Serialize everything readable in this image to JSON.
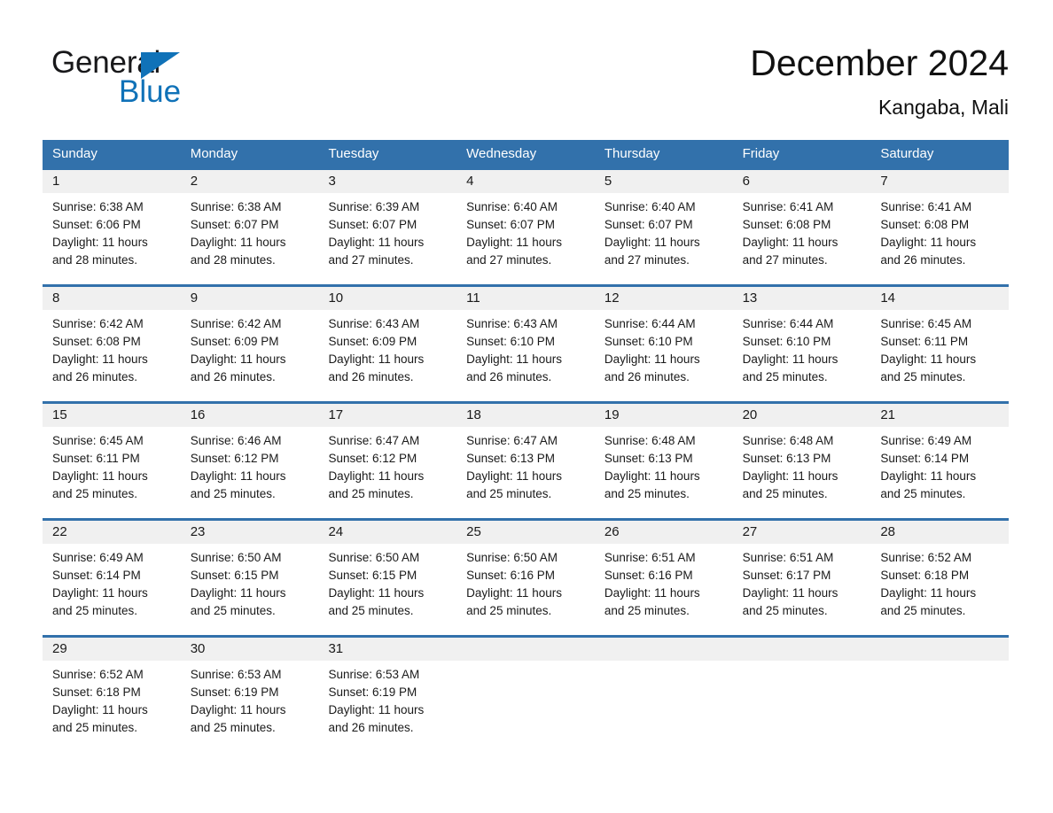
{
  "brand": {
    "name_part1": "General",
    "name_part2": "Blue",
    "logo_icon": "triangle-icon",
    "colors": {
      "blue": "#1072b8",
      "black": "#18181a"
    }
  },
  "header": {
    "title": "December 2024",
    "subtitle": "Kangaba, Mali"
  },
  "theme": {
    "header_blue": "#3271ab",
    "daybar_gray": "#f0f0f0",
    "text": "#1a1a1a",
    "page_background": "#ffffff"
  },
  "calendar": {
    "weekdays": [
      "Sunday",
      "Monday",
      "Tuesday",
      "Wednesday",
      "Thursday",
      "Friday",
      "Saturday"
    ],
    "weeks": [
      [
        {
          "day": "1",
          "sunrise": "Sunrise: 6:38 AM",
          "sunset": "Sunset: 6:06 PM",
          "daylight_line1": "Daylight: 11 hours",
          "daylight_line2": "and 28 minutes."
        },
        {
          "day": "2",
          "sunrise": "Sunrise: 6:38 AM",
          "sunset": "Sunset: 6:07 PM",
          "daylight_line1": "Daylight: 11 hours",
          "daylight_line2": "and 28 minutes."
        },
        {
          "day": "3",
          "sunrise": "Sunrise: 6:39 AM",
          "sunset": "Sunset: 6:07 PM",
          "daylight_line1": "Daylight: 11 hours",
          "daylight_line2": "and 27 minutes."
        },
        {
          "day": "4",
          "sunrise": "Sunrise: 6:40 AM",
          "sunset": "Sunset: 6:07 PM",
          "daylight_line1": "Daylight: 11 hours",
          "daylight_line2": "and 27 minutes."
        },
        {
          "day": "5",
          "sunrise": "Sunrise: 6:40 AM",
          "sunset": "Sunset: 6:07 PM",
          "daylight_line1": "Daylight: 11 hours",
          "daylight_line2": "and 27 minutes."
        },
        {
          "day": "6",
          "sunrise": "Sunrise: 6:41 AM",
          "sunset": "Sunset: 6:08 PM",
          "daylight_line1": "Daylight: 11 hours",
          "daylight_line2": "and 27 minutes."
        },
        {
          "day": "7",
          "sunrise": "Sunrise: 6:41 AM",
          "sunset": "Sunset: 6:08 PM",
          "daylight_line1": "Daylight: 11 hours",
          "daylight_line2": "and 26 minutes."
        }
      ],
      [
        {
          "day": "8",
          "sunrise": "Sunrise: 6:42 AM",
          "sunset": "Sunset: 6:08 PM",
          "daylight_line1": "Daylight: 11 hours",
          "daylight_line2": "and 26 minutes."
        },
        {
          "day": "9",
          "sunrise": "Sunrise: 6:42 AM",
          "sunset": "Sunset: 6:09 PM",
          "daylight_line1": "Daylight: 11 hours",
          "daylight_line2": "and 26 minutes."
        },
        {
          "day": "10",
          "sunrise": "Sunrise: 6:43 AM",
          "sunset": "Sunset: 6:09 PM",
          "daylight_line1": "Daylight: 11 hours",
          "daylight_line2": "and 26 minutes."
        },
        {
          "day": "11",
          "sunrise": "Sunrise: 6:43 AM",
          "sunset": "Sunset: 6:10 PM",
          "daylight_line1": "Daylight: 11 hours",
          "daylight_line2": "and 26 minutes."
        },
        {
          "day": "12",
          "sunrise": "Sunrise: 6:44 AM",
          "sunset": "Sunset: 6:10 PM",
          "daylight_line1": "Daylight: 11 hours",
          "daylight_line2": "and 26 minutes."
        },
        {
          "day": "13",
          "sunrise": "Sunrise: 6:44 AM",
          "sunset": "Sunset: 6:10 PM",
          "daylight_line1": "Daylight: 11 hours",
          "daylight_line2": "and 25 minutes."
        },
        {
          "day": "14",
          "sunrise": "Sunrise: 6:45 AM",
          "sunset": "Sunset: 6:11 PM",
          "daylight_line1": "Daylight: 11 hours",
          "daylight_line2": "and 25 minutes."
        }
      ],
      [
        {
          "day": "15",
          "sunrise": "Sunrise: 6:45 AM",
          "sunset": "Sunset: 6:11 PM",
          "daylight_line1": "Daylight: 11 hours",
          "daylight_line2": "and 25 minutes."
        },
        {
          "day": "16",
          "sunrise": "Sunrise: 6:46 AM",
          "sunset": "Sunset: 6:12 PM",
          "daylight_line1": "Daylight: 11 hours",
          "daylight_line2": "and 25 minutes."
        },
        {
          "day": "17",
          "sunrise": "Sunrise: 6:47 AM",
          "sunset": "Sunset: 6:12 PM",
          "daylight_line1": "Daylight: 11 hours",
          "daylight_line2": "and 25 minutes."
        },
        {
          "day": "18",
          "sunrise": "Sunrise: 6:47 AM",
          "sunset": "Sunset: 6:13 PM",
          "daylight_line1": "Daylight: 11 hours",
          "daylight_line2": "and 25 minutes."
        },
        {
          "day": "19",
          "sunrise": "Sunrise: 6:48 AM",
          "sunset": "Sunset: 6:13 PM",
          "daylight_line1": "Daylight: 11 hours",
          "daylight_line2": "and 25 minutes."
        },
        {
          "day": "20",
          "sunrise": "Sunrise: 6:48 AM",
          "sunset": "Sunset: 6:13 PM",
          "daylight_line1": "Daylight: 11 hours",
          "daylight_line2": "and 25 minutes."
        },
        {
          "day": "21",
          "sunrise": "Sunrise: 6:49 AM",
          "sunset": "Sunset: 6:14 PM",
          "daylight_line1": "Daylight: 11 hours",
          "daylight_line2": "and 25 minutes."
        }
      ],
      [
        {
          "day": "22",
          "sunrise": "Sunrise: 6:49 AM",
          "sunset": "Sunset: 6:14 PM",
          "daylight_line1": "Daylight: 11 hours",
          "daylight_line2": "and 25 minutes."
        },
        {
          "day": "23",
          "sunrise": "Sunrise: 6:50 AM",
          "sunset": "Sunset: 6:15 PM",
          "daylight_line1": "Daylight: 11 hours",
          "daylight_line2": "and 25 minutes."
        },
        {
          "day": "24",
          "sunrise": "Sunrise: 6:50 AM",
          "sunset": "Sunset: 6:15 PM",
          "daylight_line1": "Daylight: 11 hours",
          "daylight_line2": "and 25 minutes."
        },
        {
          "day": "25",
          "sunrise": "Sunrise: 6:50 AM",
          "sunset": "Sunset: 6:16 PM",
          "daylight_line1": "Daylight: 11 hours",
          "daylight_line2": "and 25 minutes."
        },
        {
          "day": "26",
          "sunrise": "Sunrise: 6:51 AM",
          "sunset": "Sunset: 6:16 PM",
          "daylight_line1": "Daylight: 11 hours",
          "daylight_line2": "and 25 minutes."
        },
        {
          "day": "27",
          "sunrise": "Sunrise: 6:51 AM",
          "sunset": "Sunset: 6:17 PM",
          "daylight_line1": "Daylight: 11 hours",
          "daylight_line2": "and 25 minutes."
        },
        {
          "day": "28",
          "sunrise": "Sunrise: 6:52 AM",
          "sunset": "Sunset: 6:18 PM",
          "daylight_line1": "Daylight: 11 hours",
          "daylight_line2": "and 25 minutes."
        }
      ],
      [
        {
          "day": "29",
          "sunrise": "Sunrise: 6:52 AM",
          "sunset": "Sunset: 6:18 PM",
          "daylight_line1": "Daylight: 11 hours",
          "daylight_line2": "and 25 minutes."
        },
        {
          "day": "30",
          "sunrise": "Sunrise: 6:53 AM",
          "sunset": "Sunset: 6:19 PM",
          "daylight_line1": "Daylight: 11 hours",
          "daylight_line2": "and 25 minutes."
        },
        {
          "day": "31",
          "sunrise": "Sunrise: 6:53 AM",
          "sunset": "Sunset: 6:19 PM",
          "daylight_line1": "Daylight: 11 hours",
          "daylight_line2": "and 26 minutes."
        },
        {
          "day": "",
          "sunrise": "",
          "sunset": "",
          "daylight_line1": "",
          "daylight_line2": ""
        },
        {
          "day": "",
          "sunrise": "",
          "sunset": "",
          "daylight_line1": "",
          "daylight_line2": ""
        },
        {
          "day": "",
          "sunrise": "",
          "sunset": "",
          "daylight_line1": "",
          "daylight_line2": ""
        },
        {
          "day": "",
          "sunrise": "",
          "sunset": "",
          "daylight_line1": "",
          "daylight_line2": ""
        }
      ]
    ]
  }
}
